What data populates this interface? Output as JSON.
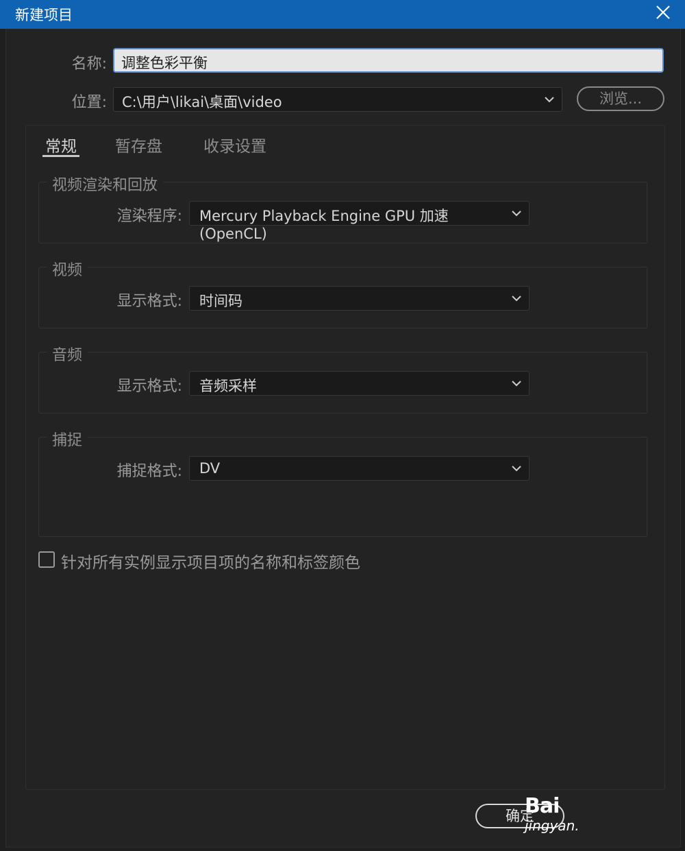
{
  "window": {
    "title": "新建项目"
  },
  "form": {
    "name_label": "名称:",
    "name_value": "调整色彩平衡",
    "location_label": "位置:",
    "location_value": "C:\\用户\\likai\\桌面\\video",
    "browse_label": "浏览..."
  },
  "tabs": [
    {
      "label": "常规",
      "active": true
    },
    {
      "label": "暂存盘",
      "active": false
    },
    {
      "label": "收录设置",
      "active": false
    }
  ],
  "groups": {
    "render": {
      "title": "视频渲染和回放",
      "field_label": "渲染程序:",
      "value": "Mercury Playback Engine GPU 加速 (OpenCL)"
    },
    "video": {
      "title": "视频",
      "field_label": "显示格式:",
      "value": "时间码"
    },
    "audio": {
      "title": "音频",
      "field_label": "显示格式:",
      "value": "音频采样"
    },
    "capture": {
      "title": "捕捉",
      "field_label": "捕捉格式:",
      "value": "DV"
    }
  },
  "option": {
    "label": "针对所有实例显示项目项的名称和标签颜色",
    "checked": false
  },
  "footer": {
    "ok_label": "确定"
  },
  "watermark": {
    "logo": "Bai",
    "text": "jingyan."
  },
  "colors": {
    "titlebar": "#0f63b2",
    "background": "#232323",
    "focus_border": "#5b8fd3"
  }
}
